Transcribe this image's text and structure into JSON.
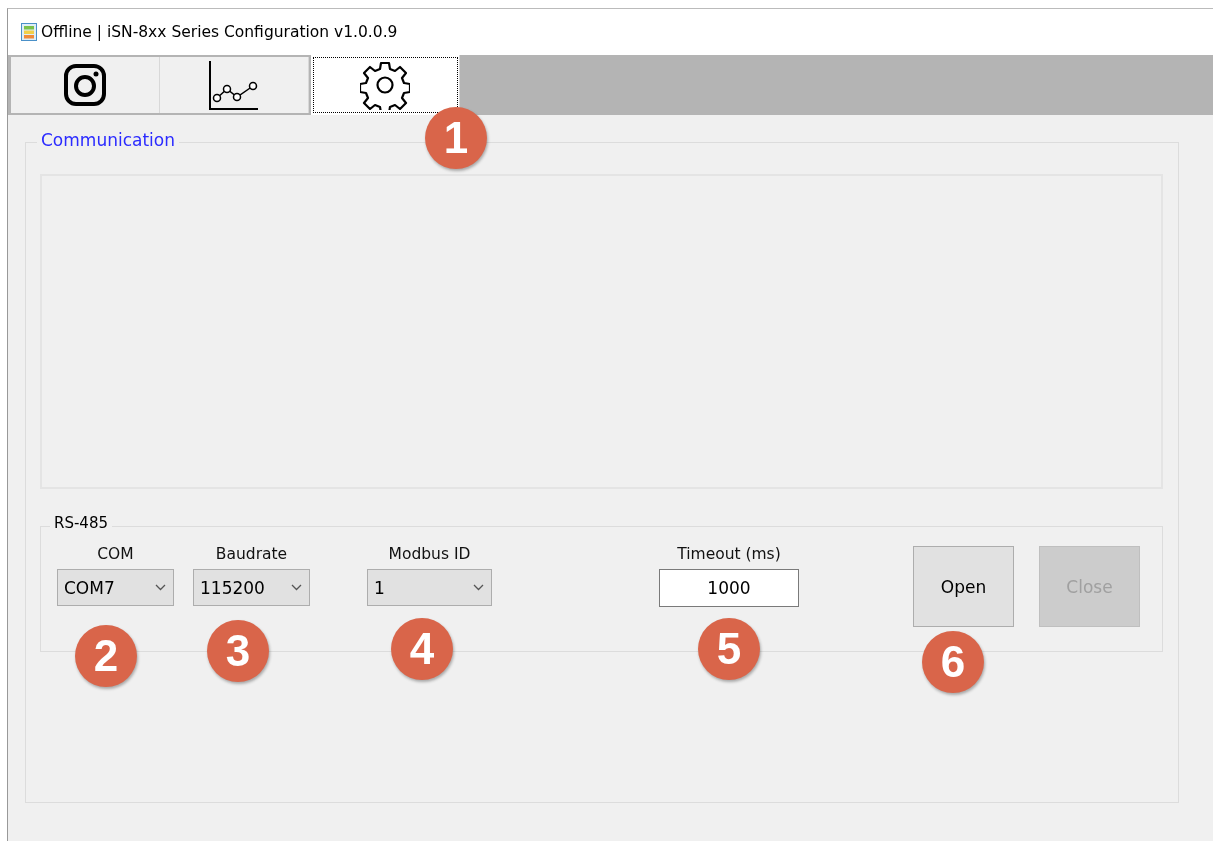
{
  "window": {
    "title": "Offline | iSN-8xx Series Configuration v1.0.0.9"
  },
  "tabs": [
    {
      "kind": "camera",
      "selected": false
    },
    {
      "kind": "chart",
      "selected": false
    },
    {
      "kind": "gear",
      "selected": true
    }
  ],
  "communication": {
    "title": "Communication",
    "rs485": {
      "title": "RS-485",
      "fields": [
        {
          "kind": "combo",
          "label": "COM",
          "value": "COM7"
        },
        {
          "kind": "combo",
          "label": "Baudrate",
          "value": "115200"
        },
        {
          "kind": "combo",
          "label": "Modbus ID",
          "value": "1"
        },
        {
          "kind": "text",
          "label": "Timeout (ms)",
          "value": "1000"
        }
      ],
      "buttons": [
        {
          "label": "Open",
          "disabled": false
        },
        {
          "label": "Close",
          "disabled": true
        }
      ]
    }
  },
  "callouts": [
    "1",
    "2",
    "3",
    "4",
    "5",
    "6"
  ]
}
